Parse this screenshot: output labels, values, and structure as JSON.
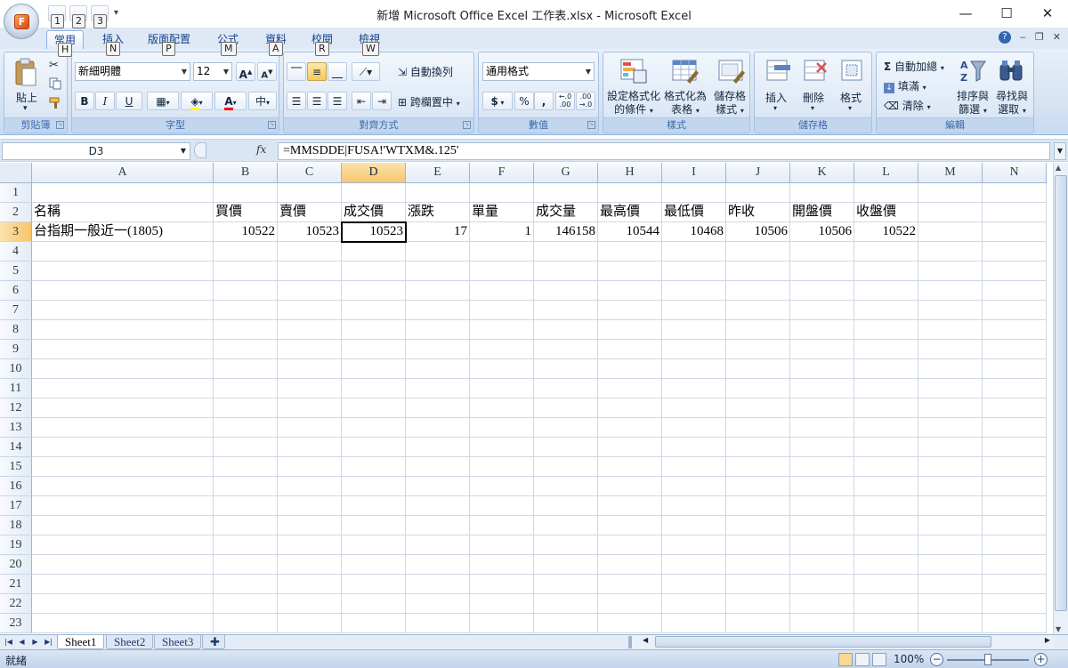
{
  "window": {
    "title": "新增 Microsoft Office Excel 工作表.xlsx - Microsoft Excel",
    "minimize": "—",
    "maximize": "☐",
    "close": "✕"
  },
  "office_button": {
    "logo": "F"
  },
  "qat": {
    "keytips": [
      "1",
      "2",
      "3"
    ],
    "more": "▾"
  },
  "tabs": [
    {
      "label": "常用",
      "keytip": "H",
      "active": true
    },
    {
      "label": "插入",
      "keytip": "N"
    },
    {
      "label": "版面配置",
      "keytip": "P"
    },
    {
      "label": "公式",
      "keytip": "M"
    },
    {
      "label": "資料",
      "keytip": "A"
    },
    {
      "label": "校閱",
      "keytip": "R"
    },
    {
      "label": "檢視",
      "keytip": "W"
    }
  ],
  "ribbon": {
    "clipboard": {
      "label": "剪貼簿",
      "paste": "貼上"
    },
    "font": {
      "label": "字型",
      "font_name": "新細明體",
      "font_size": "12",
      "grow": "A",
      "shrink": "A",
      "bold": "B",
      "italic": "I",
      "underline": "U",
      "font_color": "A",
      "phonetic": "中"
    },
    "alignment": {
      "label": "對齊方式",
      "wrap_text": "自動換列",
      "merge_center": "跨欄置中"
    },
    "number": {
      "label": "數值",
      "format": "通用格式",
      "currency": "$",
      "percent": "%",
      "comma": ",",
      "inc_decimal": "←.0\n.00",
      "dec_decimal": ".00\n→.0"
    },
    "styles": {
      "label": "樣式",
      "conditional": [
        "設定格式化",
        "的條件"
      ],
      "as_table": [
        "格式化為",
        "表格"
      ],
      "cell_styles": [
        "儲存格",
        "樣式"
      ]
    },
    "cells": {
      "label": "儲存格",
      "insert": "插入",
      "delete": "刪除",
      "format": "格式"
    },
    "editing": {
      "label": "編輯",
      "autosum": "自動加總",
      "fill": "填滿",
      "clear": "清除",
      "sort_filter": [
        "排序與",
        "篩選"
      ],
      "find_select": [
        "尋找與",
        "選取"
      ]
    }
  },
  "formula_bar": {
    "name_box": "D3",
    "fx": "fx",
    "formula": "=MMSDDE|FUSA!'WTXM&.125'"
  },
  "columns": [
    "A",
    "B",
    "C",
    "D",
    "E",
    "F",
    "G",
    "H",
    "I",
    "J",
    "K",
    "L",
    "M",
    "N"
  ],
  "selected_column": "D",
  "row_numbers": [
    "1",
    "2",
    "3",
    "4",
    "5",
    "6",
    "7",
    "8",
    "9",
    "10",
    "11",
    "12",
    "13",
    "14",
    "15",
    "16",
    "17",
    "18",
    "19",
    "20",
    "21",
    "22",
    "23"
  ],
  "selected_row": "3",
  "sheet": {
    "headers": [
      "名稱",
      "買價",
      "賣價",
      "成交價",
      "漲跌",
      "單量",
      "成交量",
      "最高價",
      "最低價",
      "昨收",
      "開盤價",
      "收盤價"
    ],
    "row3": [
      "台指期一般近一(1805)",
      "10522",
      "10523",
      "10523",
      "17",
      "1",
      "146158",
      "10544",
      "10468",
      "10506",
      "10506",
      "10522"
    ]
  },
  "active_cell": "D3",
  "sheet_tabs": [
    "Sheet1",
    "Sheet2",
    "Sheet3"
  ],
  "active_sheet": "Sheet1",
  "status": {
    "ready": "就緒",
    "zoom": "100%",
    "zoom_minus": "−",
    "zoom_plus": "+"
  },
  "colors": {
    "ribbon_bg": "#dfe9f5",
    "selected_header": "#f7c56f",
    "grid_line": "#d0d7e5"
  }
}
